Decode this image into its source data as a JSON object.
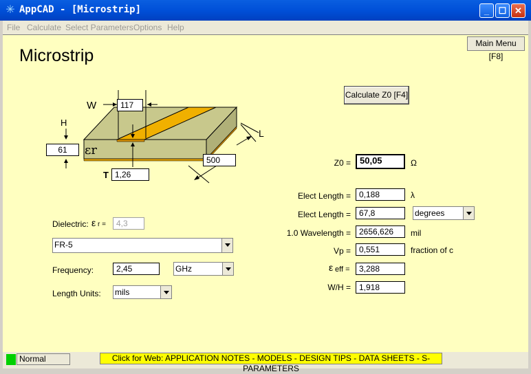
{
  "window": {
    "title": "AppCAD - [Microstrip]"
  },
  "menu": [
    "File",
    "Calculate",
    "Select Parameters",
    "Options",
    "Help"
  ],
  "page_title": "Microstrip",
  "main_menu_label": "Main Menu [F8]",
  "calculate_label": "Calculate Z0  [F4]",
  "drawing": {
    "W_label": "W",
    "W_value": "117",
    "H_label": "H",
    "H_value": "61",
    "T_label": "T",
    "T_value": "1,26",
    "L_label": "L",
    "L_value": "500",
    "er_label": "εr"
  },
  "dielectric": {
    "label": "Dielectric:",
    "er_symbol": "ε",
    "er_sub": "r =",
    "er_value": "4,3",
    "material": "FR-5"
  },
  "frequency": {
    "label": "Frequency:",
    "value": "2,45",
    "unit": "GHz"
  },
  "length_units": {
    "label": "Length Units:",
    "value": "mils"
  },
  "results": {
    "z0": {
      "label": "Z0 =",
      "value": "50,05",
      "unit": "Ω"
    },
    "elect_length_lambda": {
      "label": "Elect Length =",
      "value": "0,188",
      "unit": "λ"
    },
    "elect_length_deg": {
      "label": "Elect Length =",
      "value": "67,8",
      "unit": "degrees"
    },
    "wavelength": {
      "label": "1.0 Wavelength =",
      "value": "2656,626",
      "unit": "mil"
    },
    "vp": {
      "label": "Vp =",
      "value": "0,551",
      "unit": "fraction of c"
    },
    "eeff": {
      "symbol": "ε",
      "sub": "eff =",
      "value": "3,288"
    },
    "wh": {
      "label": "W/H =",
      "value": "1,918"
    }
  },
  "status": {
    "mode": "Normal",
    "web_link": "Click for Web: APPLICATION NOTES - MODELS - DESIGN TIPS - DATA SHEETS - S-PARAMETERS"
  }
}
